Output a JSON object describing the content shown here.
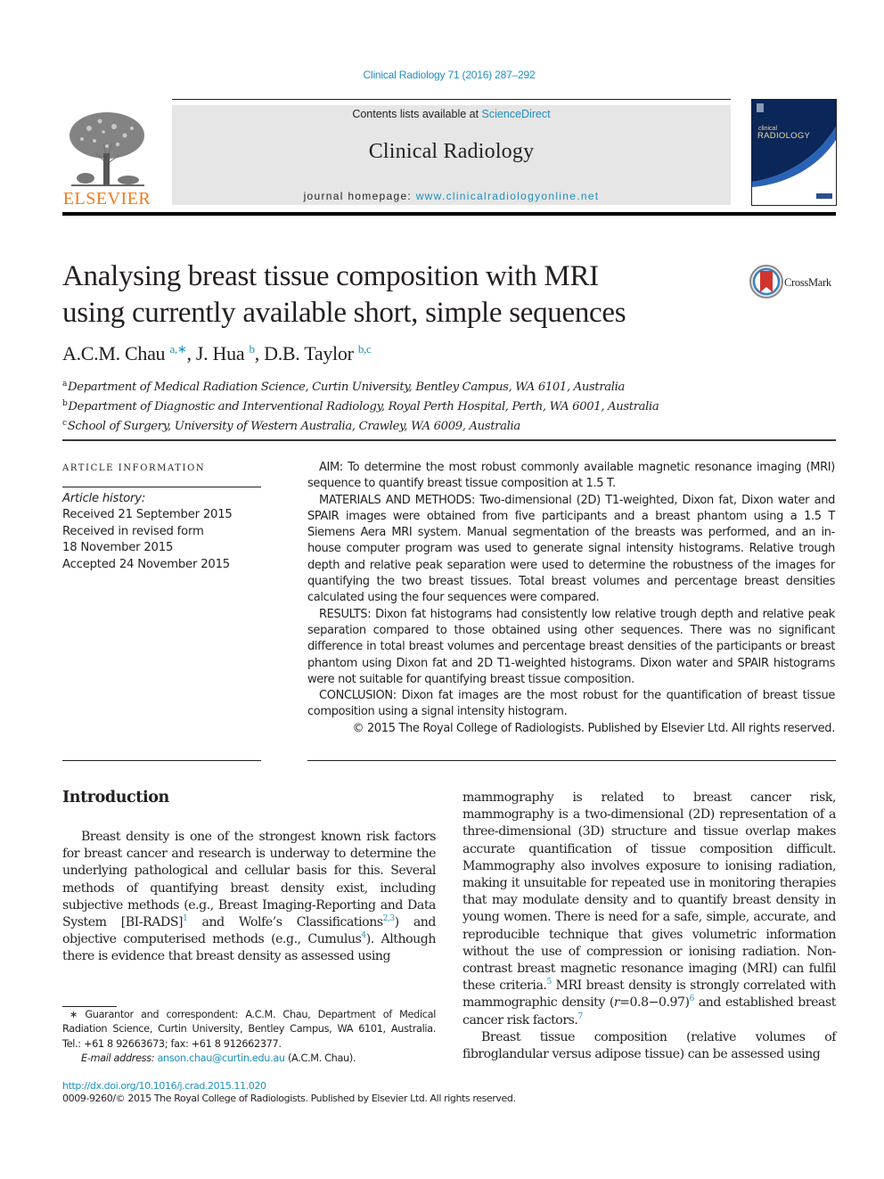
{
  "header": {
    "citation": "Clinical Radiology 71 (2016) 287–292",
    "contents_prefix": "Contents lists available at ",
    "contents_link": "ScienceDirect",
    "journal_name": "Clinical Radiology",
    "homepage_prefix": "journal homepage: ",
    "homepage_link": "www.clinicalradiologyonline.net",
    "publisher_logo_text": "ELSEVIER",
    "cover_small_text": "clinical",
    "cover_title": "RADIOLOGY",
    "colors": {
      "link": "#1f8fbf",
      "elsevier_orange": "#f07c1e",
      "cover_blue": "#0b2658",
      "masthead_gray": "#e6e6e6"
    }
  },
  "article": {
    "title_line1": "Analysing breast tissue composition with MRI",
    "title_line2": "using currently available short, simple sequences",
    "crossmark_label": "CrossMark",
    "authors": [
      {
        "name": "A.C.M. Chau",
        "sup": "a,∗",
        "sep": ", "
      },
      {
        "name": "J. Hua",
        "sup": "b",
        "sep": ", "
      },
      {
        "name": "D.B. Taylor",
        "sup": "b,c",
        "sep": ""
      }
    ],
    "affiliations": [
      {
        "key": "a",
        "text": "Department of Medical Radiation Science, Curtin University, Bentley Campus, WA 6101, Australia"
      },
      {
        "key": "b",
        "text": "Department of Diagnostic and Interventional Radiology, Royal Perth Hospital, Perth, WA 6001, Australia"
      },
      {
        "key": "c",
        "text": "School of Surgery, University of Western Australia, Crawley, WA 6009, Australia"
      }
    ]
  },
  "article_info": {
    "heading": "ARTICLE INFORMATION",
    "history_label": "Article history:",
    "history": [
      "Received 21 September 2015",
      "Received in revised form",
      "18 November 2015",
      "Accepted 24 November 2015"
    ]
  },
  "abstract": {
    "aim": "AIM: To determine the most robust commonly available magnetic resonance imaging (MRI) sequence to quantify breast tissue composition at 1.5 T.",
    "methods": "MATERIALS AND METHODS: Two-dimensional (2D) T1-weighted, Dixon fat, Dixon water and SPAIR images were obtained from five participants and a breast phantom using a 1.5 T Siemens Aera MRI system. Manual segmentation of the breasts was performed, and an in-house computer program was used to generate signal intensity histograms. Relative trough depth and relative peak separation were used to determine the robustness of the images for quantifying the two breast tissues. Total breast volumes and percentage breast densities calculated using the four sequences were compared.",
    "results": "RESULTS: Dixon fat histograms had consistently low relative trough depth and relative peak separation compared to those obtained using other sequences. There was no significant difference in total breast volumes and percentage breast densities of the participants or breast phantom using Dixon fat and 2D T1-weighted histograms. Dixon water and SPAIR histograms were not suitable for quantifying breast tissue composition.",
    "conclusion": "CONCLUSION: Dixon fat images are the most robust for the quantification of breast tissue composition using a signal intensity histogram.",
    "copyright": "© 2015 The Royal College of Radiologists. Published by Elsevier Ltd. All rights reserved."
  },
  "introduction": {
    "heading": "Introduction",
    "left": {
      "p1_a": "Breast density is one of the strongest known risk factors for breast cancer and research is underway to determine the underlying pathological and cellular basis for this. Several methods of quantifying breast density exist, including subjective methods (e.g., Breast Imaging-Reporting and Data System [BI-RADS]",
      "ref1": "1",
      "p1_b": " and Wolfe’s Classifications",
      "ref2": "2,3",
      "p1_c": ") and objective computerised methods (e.g., Cumulus",
      "ref3": "4",
      "p1_d": "). Although there is evidence that breast density as assessed using"
    },
    "right": {
      "p1_a": "mammography is related to breast cancer risk, mammography is a two-dimensional (2D) representation of a three-dimensional (3D) structure and tissue overlap makes accurate quantification of tissue composition difficult. Mammography also involves exposure to ionising radiation, making it unsuitable for repeated use in monitoring therapies that may modulate density and to quantify breast density in young women. There is need for a safe, simple, accurate, and reproducible technique that gives volumetric information without the use of compression or ionising radiation. Non-contrast breast magnetic resonance imaging (MRI) can fulfil these criteria.",
      "ref1": "5",
      "p1_b": " MRI breast density is strongly correlated with mammographic density (",
      "r_symbol": "r",
      "p1_c": "=0.8−0.97)",
      "ref2": "6",
      "p1_d": " and established breast cancer risk factors.",
      "ref3": "7",
      "p2": "Breast tissue composition (relative volumes of fibroglandular versus adipose tissue) can be assessed using"
    }
  },
  "footnote": {
    "text": "∗ Guarantor and correspondent: A.C.M. Chau, Department of Medical Radiation Science, Curtin University, Bentley Campus, WA 6101, Australia. Tel.: +61 8 92663673; fax: +61 8 912662377.",
    "email_label": "E-mail address:",
    "email": "anson.chau@curtin.edu.au",
    "email_suffix": " (A.C.M. Chau)."
  },
  "footer": {
    "doi": "http://dx.doi.org/10.1016/j.crad.2015.11.020",
    "issn_line": "0009-9260/© 2015 The Royal College of Radiologists. Published by Elsevier Ltd. All rights reserved."
  }
}
